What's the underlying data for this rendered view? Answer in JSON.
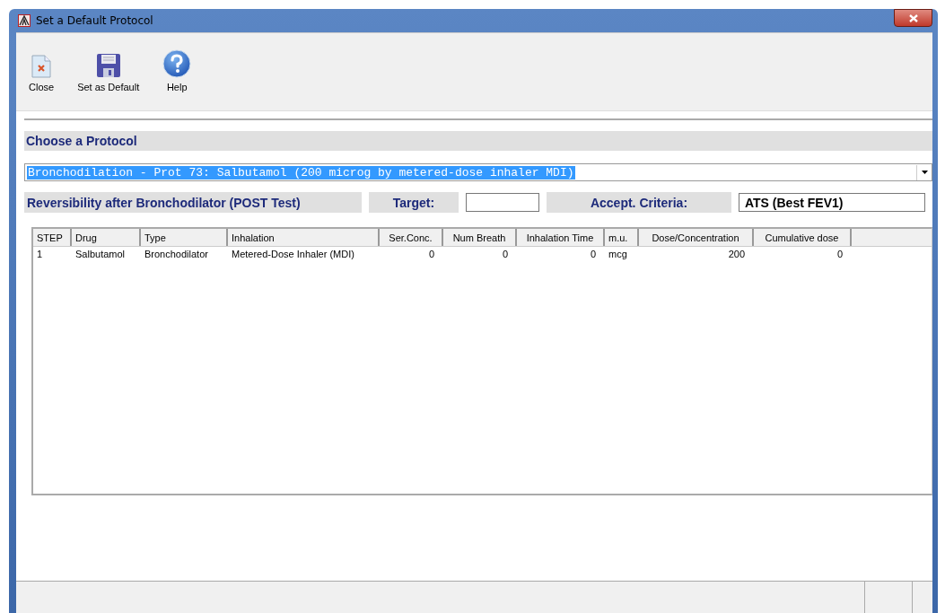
{
  "window": {
    "title": "Set a Default Protocol"
  },
  "toolbar": [
    {
      "kind": "close",
      "label": "Close"
    },
    {
      "kind": "save",
      "label": "Set as Default"
    },
    {
      "kind": "help",
      "label": "Help"
    }
  ],
  "protocol": {
    "heading": "Choose a  Protocol",
    "selected_protocol": "Bronchodilation - Prot 73: Salbutamol (200 microg by metered-dose inhaler MDI)",
    "test_label": "Reversibility after Bronchodilator (POST Test)",
    "target_label": "Target:",
    "criteria_label": "Accept. Criteria:",
    "criteria_value": "ATS (Best FEV1)"
  },
  "table": {
    "columns": [
      {
        "label": "STEP",
        "kind": "text"
      },
      {
        "label": "Drug",
        "kind": "text"
      },
      {
        "label": "Type",
        "kind": "text"
      },
      {
        "label": "Inhalation",
        "kind": "text"
      },
      {
        "label": "Ser.Conc.",
        "kind": "number"
      },
      {
        "label": "Num Breath",
        "kind": "number"
      },
      {
        "label": "Inhalation Time",
        "kind": "number"
      },
      {
        "label": "m.u.",
        "kind": "text"
      },
      {
        "label": "Dose/Concentration",
        "kind": "number"
      },
      {
        "label": "Cumulative dose",
        "kind": "number"
      }
    ],
    "rows": [
      [
        "1",
        "Salbutamol",
        "Bronchodilator",
        "Metered-Dose Inhaler (MDI)",
        "0",
        "0",
        "0",
        "mcg",
        "200",
        "0"
      ]
    ]
  }
}
